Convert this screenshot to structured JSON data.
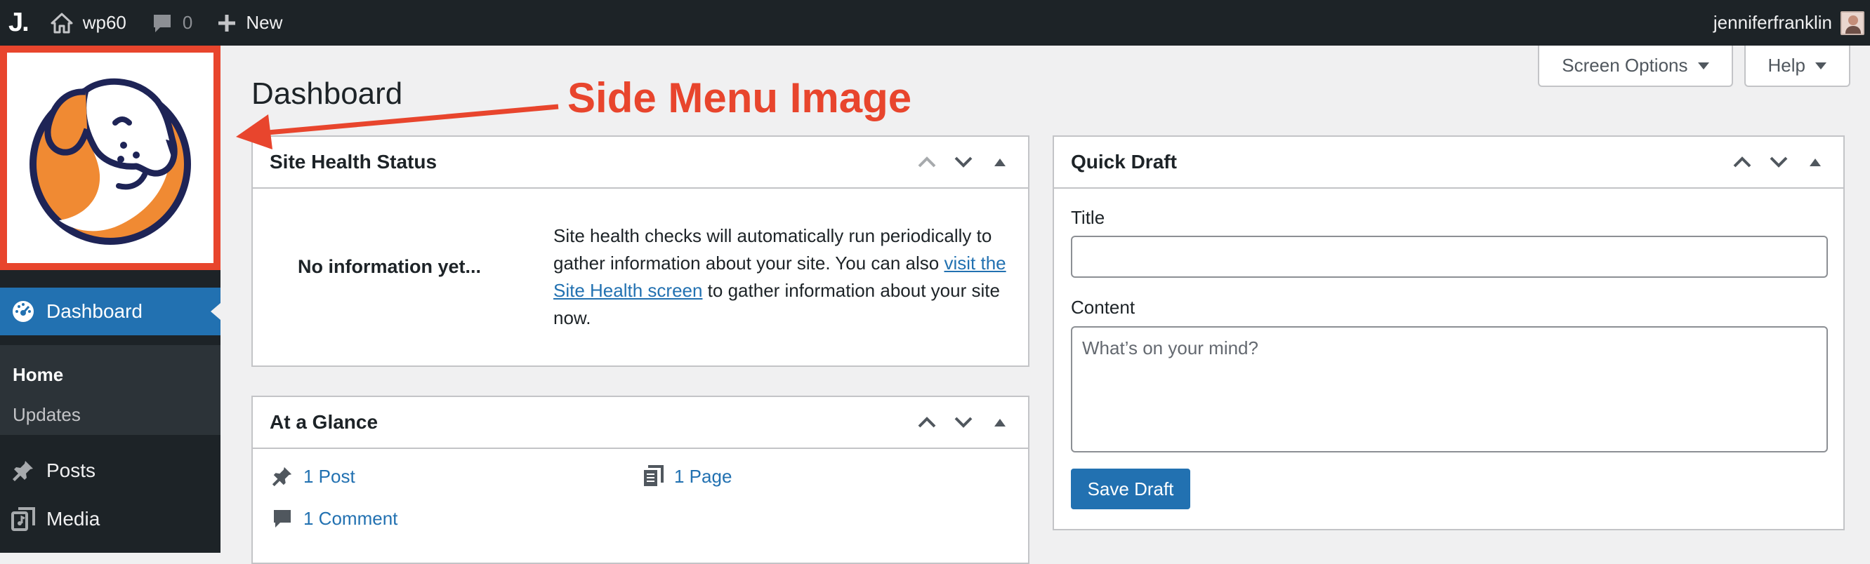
{
  "admin_bar": {
    "logo": "J.",
    "site_name": "wp60",
    "comments_count": "0",
    "new_label": "New",
    "username": "jenniferfranklin"
  },
  "side_menu": {
    "items": [
      {
        "label": "Dashboard",
        "icon": "dashboard-icon",
        "current": true
      },
      {
        "label": "Posts",
        "icon": "pin-icon"
      },
      {
        "label": "Media",
        "icon": "media-icon"
      }
    ],
    "submenu": [
      {
        "label": "Home",
        "current": true
      },
      {
        "label": "Updates"
      }
    ]
  },
  "annotation": {
    "text": "Side Menu Image",
    "color": "#e8452d"
  },
  "screen_meta": {
    "screen_options": "Screen Options",
    "help": "Help"
  },
  "page_title": "Dashboard",
  "site_health": {
    "title": "Site Health Status",
    "no_info": "No information yet...",
    "desc_before": "Site health checks will automatically run periodically to gather information about your site. You can also ",
    "link_text": "visit the Site Health screen",
    "desc_after": " to gather information about your site now."
  },
  "at_a_glance": {
    "title": "At a Glance",
    "posts": "1 Post",
    "pages": "1 Page",
    "comments": "1 Comment"
  },
  "quick_draft": {
    "title": "Quick Draft",
    "title_label": "Title",
    "title_value": "",
    "content_label": "Content",
    "content_placeholder": "What’s on your mind?",
    "save_label": "Save Draft"
  },
  "colors": {
    "admin_bar": "#1d2327",
    "accent": "#2271b1",
    "annotation": "#e8452d",
    "logo_orange": "#f08a33",
    "logo_navy": "#1e2456"
  }
}
